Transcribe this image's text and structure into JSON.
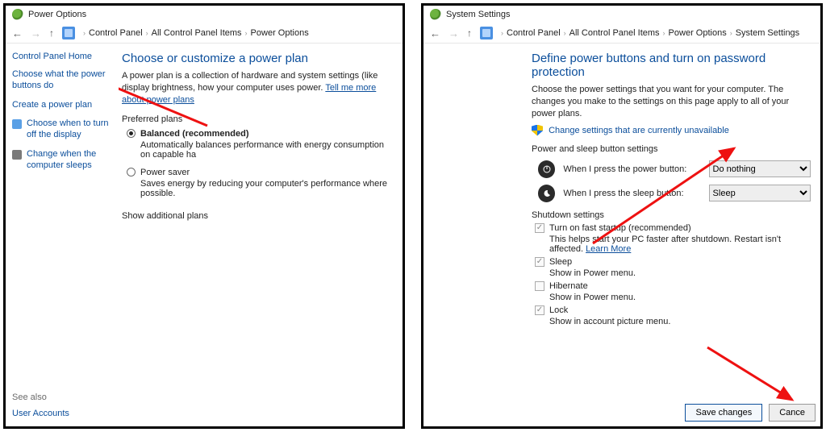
{
  "left": {
    "title": "Power Options",
    "breadcrumb": [
      "Control Panel",
      "All Control Panel Items",
      "Power Options"
    ],
    "sidebar": {
      "home": "Control Panel Home",
      "links": [
        "Choose what the power buttons do",
        "Create a power plan",
        "Choose when to turn off the display",
        "Change when the computer sleeps"
      ],
      "see_also": "See also",
      "user_accounts": "User Accounts"
    },
    "heading": "Choose or customize a power plan",
    "intro": "A power plan is a collection of hardware and system settings (like display brightness, how your computer uses power.",
    "intro_link": "Tell me more about power plans",
    "preferred": "Preferred plans",
    "plans": [
      {
        "name": "Balanced (recommended)",
        "selected": true,
        "desc": "Automatically balances performance with energy consumption on capable ha"
      },
      {
        "name": "Power saver",
        "selected": false,
        "desc": "Saves energy by reducing your computer's performance where possible."
      }
    ],
    "show_more": "Show additional plans"
  },
  "right": {
    "title": "System Settings",
    "breadcrumb": [
      "Control Panel",
      "All Control Panel Items",
      "Power Options",
      "System Settings"
    ],
    "heading": "Define power buttons and turn on password protection",
    "intro": "Choose the power settings that you want for your computer. The changes you make to the settings on this page apply to all of your power plans.",
    "unlock": "Change settings that are currently unavailable",
    "section_buttons": "Power and sleep button settings",
    "rows": [
      {
        "label": "When I press the power button:",
        "value": "Do nothing"
      },
      {
        "label": "When I press the sleep button:",
        "value": "Sleep"
      }
    ],
    "section_shutdown": "Shutdown settings",
    "checks": [
      {
        "label": "Turn on fast startup (recommended)",
        "note": "This helps start your PC faster after shutdown. Restart isn't affected.",
        "note_link": "Learn More",
        "checked": true
      },
      {
        "label": "Sleep",
        "note": "Show in Power menu.",
        "checked": true
      },
      {
        "label": "Hibernate",
        "note": "Show in Power menu.",
        "checked": false
      },
      {
        "label": "Lock",
        "note": "Show in account picture menu.",
        "checked": true
      }
    ],
    "save": "Save changes",
    "cancel": "Cance"
  }
}
